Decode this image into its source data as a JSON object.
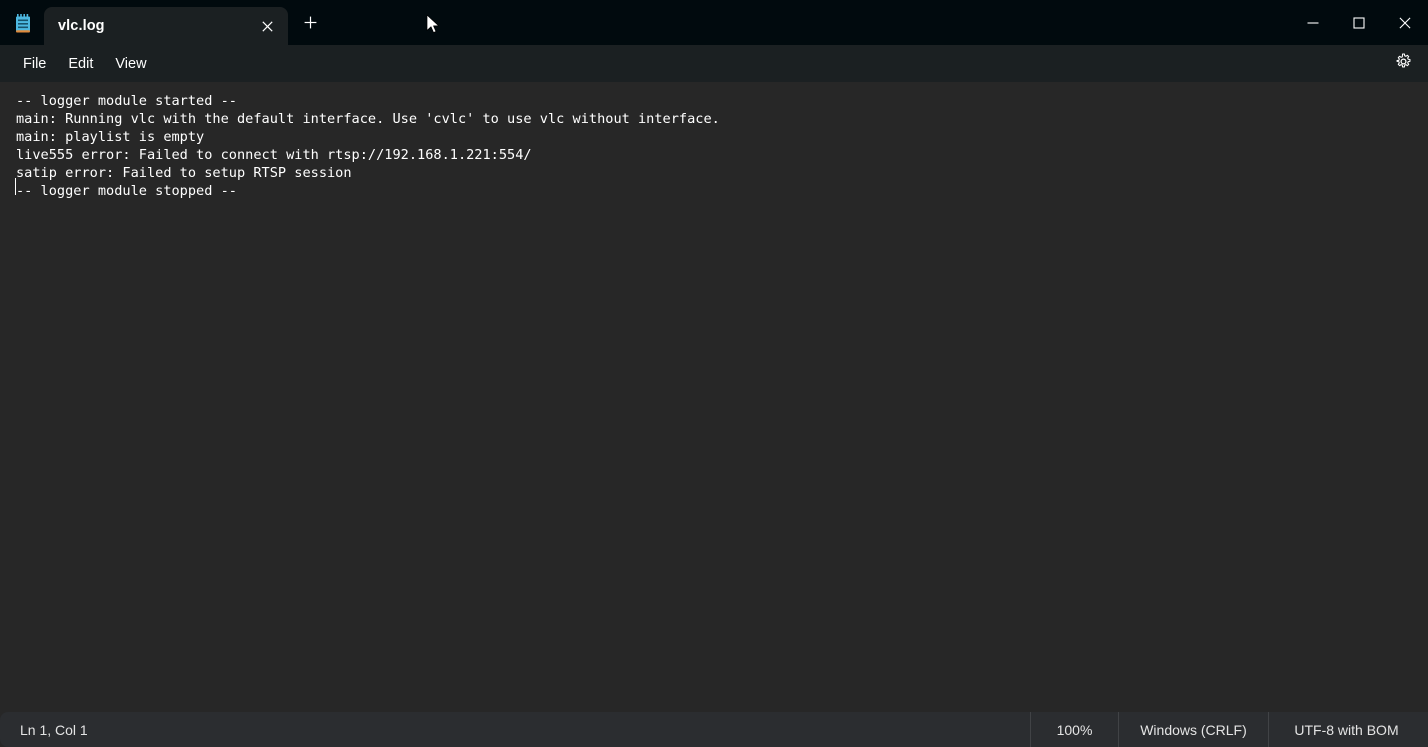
{
  "window": {
    "app_icon": "notepad-icon",
    "controls": {
      "minimize": "minimize-icon",
      "maximize": "maximize-icon",
      "close": "close-icon"
    }
  },
  "tabs": {
    "active_index": 0,
    "items": [
      {
        "label": "vlc.log",
        "close_icon": "close-icon"
      }
    ],
    "new_tab_icon": "plus-icon",
    "new_tab_label": "+"
  },
  "menubar": {
    "items": [
      {
        "label": "File"
      },
      {
        "label": "Edit"
      },
      {
        "label": "View"
      }
    ],
    "settings_icon": "gear-icon"
  },
  "editor": {
    "lines": [
      "-- logger module started --",
      "main: Running vlc with the default interface. Use 'cvlc' to use vlc without interface.",
      "main: playlist is empty",
      "live555 error: Failed to connect with rtsp://192.168.1.221:554/",
      "satip error: Failed to setup RTSP session",
      "-- logger module stopped --"
    ],
    "content": "-- logger module started --\nmain: Running vlc with the default interface. Use 'cvlc' to use vlc without interface.\nmain: playlist is empty\nlive555 error: Failed to connect with rtsp://192.168.1.221:554/\nsatip error: Failed to setup RTSP session\n-- logger module stopped --"
  },
  "statusbar": {
    "position": "Ln 1, Col 1",
    "zoom": "100%",
    "line_ending": "Windows (CRLF)",
    "encoding": "UTF-8 with BOM"
  },
  "colors": {
    "titlebar_bg": "#010a0e",
    "menubar_bg": "#1b2022",
    "editor_bg": "#272727",
    "statusbar_bg": "#2b2d30",
    "text": "#ffffff",
    "icon_blue": "#4db8e0",
    "icon_orange": "#e08a3c"
  }
}
